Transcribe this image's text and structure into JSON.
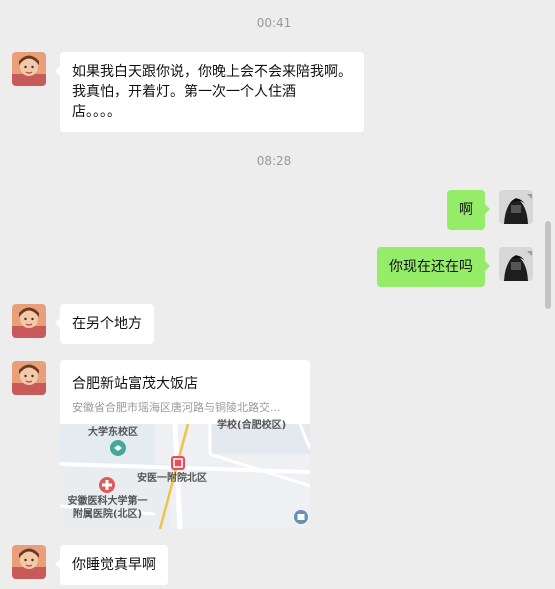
{
  "timestamps": [
    "00:41",
    "08:28"
  ],
  "messages": {
    "m1": "如果我白天跟你说，你晚上会不会来陪我啊。\n我真怕，开着灯。第一次一个人住酒\n店。。。。",
    "m2": "啊",
    "m3": "你现在还在吗",
    "m4": "在另个地方",
    "m6": "你睡觉真早啊"
  },
  "location": {
    "title": "合肥新站富茂大饭店",
    "address": "安徽省合肥市瑶海区唐河路与铜陵北路交...",
    "map_labels": {
      "campus_east": "大学东校区",
      "school": "学校(合肥校区)",
      "hospital_north": "安医一附院北区",
      "hospital_full": "安徽医科大学第一\n附属医院(北区)"
    }
  },
  "colors": {
    "background": "#ededed",
    "incoming_bubble": "#ffffff",
    "outgoing_bubble": "#95ec69",
    "timestamp": "#9a9a9a"
  }
}
